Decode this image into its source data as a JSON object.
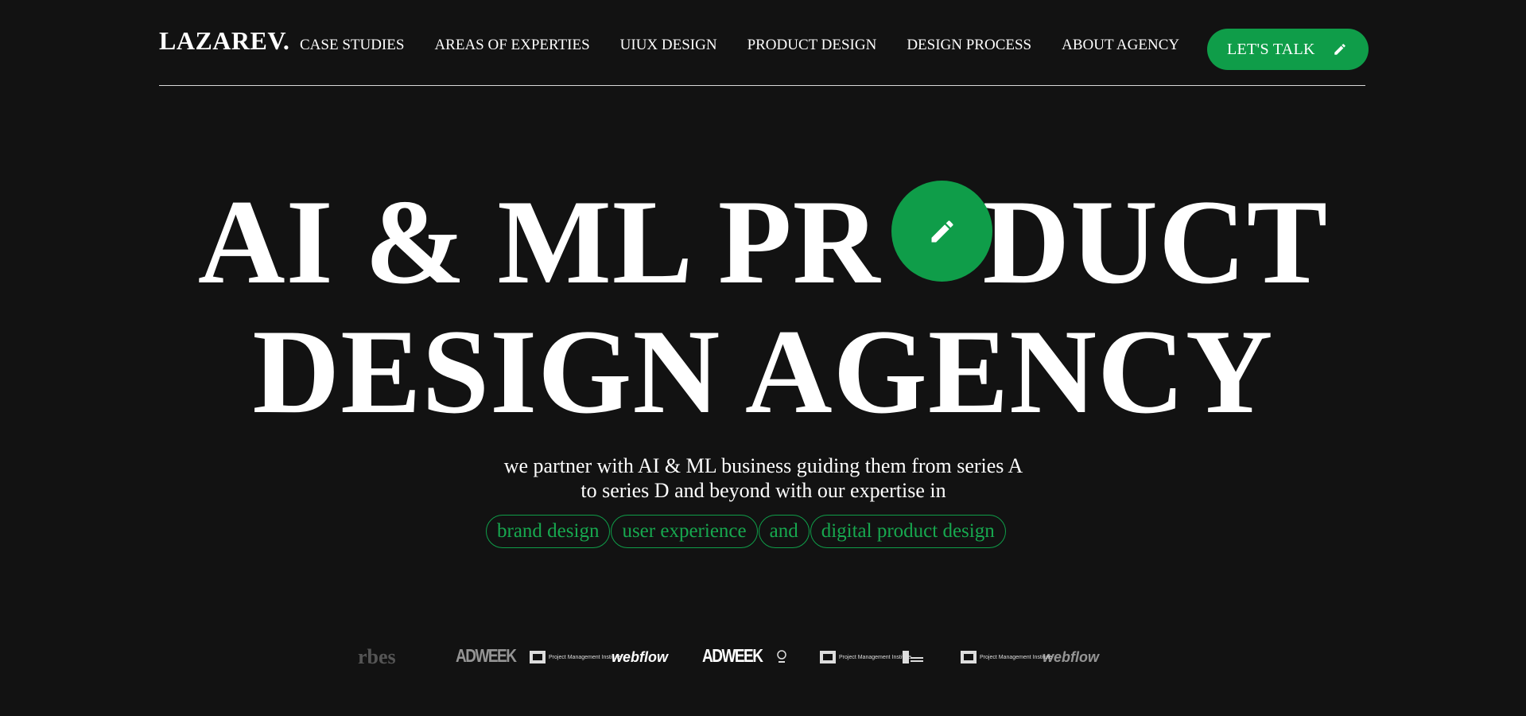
{
  "header": {
    "logo": "LAZAREV.",
    "nav": [
      "CASE STUDIES",
      "AREAS OF EXPERTIES",
      "UIUX DESIGN",
      "PRODUCT DESIGN",
      "DESIGN PROCESS",
      "ABOUT AGENCY"
    ],
    "cta_label": "LET'S TALK",
    "cta_icon": "pencil-icon"
  },
  "hero": {
    "line1_before": "AI & ML PR",
    "line1_after": "DUCT",
    "line2": "DESIGN AGENCY",
    "circle_icon": "pencil-icon"
  },
  "subtitle": {
    "line1": "we partner with AI & ML business guiding them from series A",
    "line2": "to series D and beyond with our expertise in"
  },
  "tags": [
    "brand design",
    "user experience",
    "and",
    "digital product design"
  ],
  "logos": [
    "rbes",
    "ADWEEK",
    "Project Management Institute",
    "webflow",
    "ADWEEK",
    "Project Management Institute",
    "webflow"
  ],
  "colors": {
    "background": "#121212",
    "accent": "#0f9d49",
    "text": "#ffffff"
  }
}
